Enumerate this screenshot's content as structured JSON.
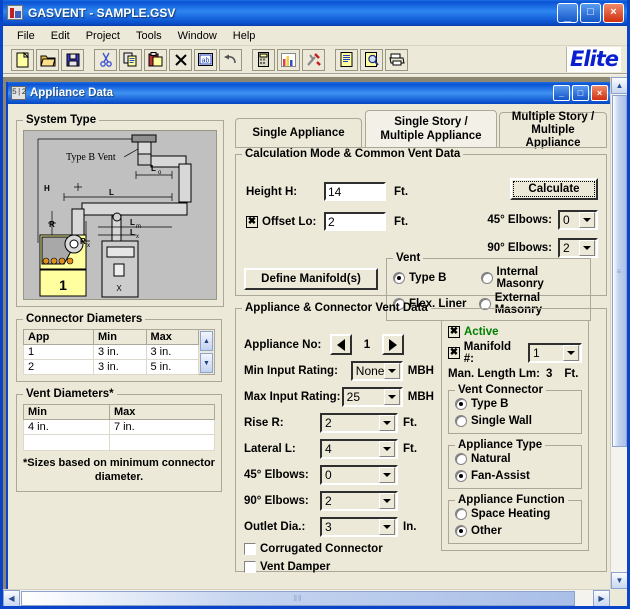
{
  "window": {
    "title": "GASVENT - SAMPLE.GSV",
    "app_icon": "gasvent-icon",
    "buttons": {
      "minimize": "_",
      "maximize": "□",
      "close": "×"
    }
  },
  "menubar": {
    "items": [
      "File",
      "Edit",
      "Project",
      "Tools",
      "Window",
      "Help"
    ]
  },
  "toolbar": {
    "brand": "Elite",
    "buttons": [
      {
        "name": "new-file-button",
        "icon": "new-document-icon"
      },
      {
        "name": "open-file-button",
        "icon": "open-folder-icon"
      },
      {
        "name": "save-file-button",
        "icon": "floppy-disk-icon"
      },
      {
        "name": "cut-button",
        "icon": "scissors-icon"
      },
      {
        "name": "copy-button",
        "icon": "copy-icon"
      },
      {
        "name": "paste-button",
        "icon": "clipboard-paste-icon"
      },
      {
        "name": "delete-button",
        "icon": "x-icon"
      },
      {
        "name": "rename-button",
        "icon": "ab-label-icon"
      },
      {
        "name": "undo-button",
        "icon": "undo-arrow-icon"
      },
      {
        "name": "calculator-button",
        "icon": "calculator-icon"
      },
      {
        "name": "chart-button",
        "icon": "bar-chart-icon"
      },
      {
        "name": "tools-button",
        "icon": "wrench-screwdriver-icon"
      },
      {
        "name": "report-button",
        "icon": "report-page-icon"
      },
      {
        "name": "preview-button",
        "icon": "print-preview-icon"
      },
      {
        "name": "print-button",
        "icon": "printer-icon"
      }
    ]
  },
  "child_window": {
    "title": "Appliance Data",
    "icon": "appliance-data-icon",
    "buttons": {
      "minimize": "_",
      "maximize": "□",
      "close": "×"
    }
  },
  "tabs": [
    {
      "label_line1": "Single Appliance",
      "label_line2": "",
      "active": false,
      "name": "tab-single-appliance"
    },
    {
      "label_line1": "Single Story /",
      "label_line2": "Multiple Appliance",
      "active": true,
      "name": "tab-single-story-multiple-appliance"
    },
    {
      "label_line1": "Multiple Story /",
      "label_line2": "Multiple Appliance",
      "active": false,
      "name": "tab-multiple-story-multiple-appliance"
    }
  ],
  "system_type": {
    "legend": "System Type",
    "diagram_labels": {
      "vent": "Type B  Vent",
      "h": "H",
      "l": "L",
      "lo": "Lo",
      "r": "R",
      "rx": "Rx",
      "lm": "Lm",
      "lx": "Lx",
      "appliance_number": "1",
      "appliance_x": "X"
    }
  },
  "connector_diameters": {
    "legend": "Connector Diameters",
    "columns": [
      "App",
      "Min",
      "Max"
    ],
    "rows": [
      [
        "1",
        "3 in.",
        "3 in."
      ],
      [
        "2",
        "3 in.",
        "5 in."
      ]
    ]
  },
  "vent_diameters": {
    "legend": "Vent Diameters*",
    "columns": [
      "Min",
      "Max"
    ],
    "rows": [
      [
        "4 in.",
        "7 in."
      ]
    ],
    "note": "*Sizes based on minimum connector diameter."
  },
  "calc_mode": {
    "legend": "Calculation Mode & Common Vent Data",
    "height_label": "Height H:",
    "height_value": "14",
    "height_unit": "Ft.",
    "offset_label": "Offset Lo:",
    "offset_checked": true,
    "offset_value": "2",
    "offset_unit": "Ft.",
    "calculate_label": "Calculate",
    "elbow45_label": "45° Elbows:",
    "elbow45_value": "0",
    "elbow90_label": "90° Elbows:",
    "elbow90_value": "2",
    "define_manifolds_label": "Define Manifold(s)",
    "vent_legend": "Vent",
    "vent_options": [
      {
        "label": "Type B",
        "selected": true
      },
      {
        "label": "Internal Masonry",
        "selected": false
      },
      {
        "label": "Flex. Liner",
        "selected": false
      },
      {
        "label": "External Masonry",
        "selected": false
      }
    ]
  },
  "appliance_data": {
    "legend": "Appliance & Connector Vent Data",
    "appliance_no_label": "Appliance No:",
    "appliance_no_value": "1",
    "prev_icon": "left-triangle-icon",
    "next_icon": "right-triangle-icon",
    "fields": [
      {
        "label": "Min Input Rating:",
        "value": "None",
        "unit": "MBH",
        "name": "min-input-rating"
      },
      {
        "label": "Max Input Rating:",
        "value": "25",
        "unit": "MBH",
        "name": "max-input-rating"
      },
      {
        "label": "Rise R:",
        "value": "2",
        "unit": "Ft.",
        "name": "rise-r"
      },
      {
        "label": "Lateral L:",
        "value": "4",
        "unit": "Ft.",
        "name": "lateral-l"
      },
      {
        "label": "45° Elbows:",
        "value": "0",
        "unit": "",
        "name": "appliance-45-elbows"
      },
      {
        "label": "90° Elbows:",
        "value": "2",
        "unit": "",
        "name": "appliance-90-elbows"
      },
      {
        "label": "Outlet Dia.:",
        "value": "3",
        "unit": "In.",
        "name": "outlet-dia"
      }
    ],
    "checkboxes": [
      {
        "label": "Corrugated Connector",
        "checked": false,
        "name": "corrugated-connector"
      },
      {
        "label": "Vent Damper",
        "checked": false,
        "name": "vent-damper"
      }
    ]
  },
  "right_panel": {
    "active_label": "Active",
    "active_checked": true,
    "active_color": "#008000",
    "manifold_label": "Manifold #:",
    "manifold_checked": true,
    "manifold_value": "1",
    "man_length_label": "Man. Length Lm:",
    "man_length_value": "3",
    "man_length_unit": "Ft.",
    "vent_connector": {
      "legend": "Vent Connector",
      "options": [
        {
          "label": "Type B",
          "selected": true
        },
        {
          "label": "Single Wall",
          "selected": false
        }
      ]
    },
    "appliance_type": {
      "legend": "Appliance Type",
      "options": [
        {
          "label": "Natural",
          "selected": false
        },
        {
          "label": "Fan-Assist",
          "selected": true
        }
      ]
    },
    "appliance_function": {
      "legend": "Appliance Function",
      "options": [
        {
          "label": "Space Heating",
          "selected": false
        },
        {
          "label": "Other",
          "selected": true
        }
      ]
    }
  },
  "scrollbars": {
    "vertical": {
      "up": "▲",
      "down": "▼",
      "grip": "≡"
    },
    "horizontal": {
      "left": "◀",
      "right": "▶",
      "grip": "‖‖"
    }
  }
}
